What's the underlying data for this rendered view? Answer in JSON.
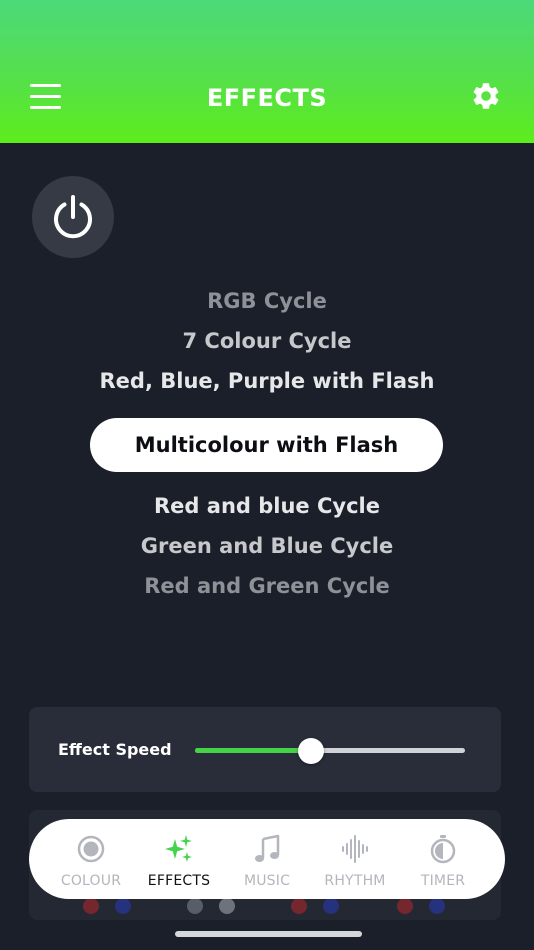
{
  "header": {
    "title": "EFFECTS",
    "background_color": "#55e04a",
    "menu_icon": "hamburger-menu-icon",
    "settings_icon": "gear-icon"
  },
  "power": {
    "icon": "power-icon"
  },
  "effects": {
    "items": [
      {
        "label": "RGB Cycle",
        "color": "#8e9197"
      },
      {
        "label": "7 Colour Cycle",
        "color": "#c6c8cc"
      },
      {
        "label": "Red, Blue, Purple with Flash",
        "color": "#e6e7e9"
      },
      {
        "label": "Multicolour with Flash",
        "selected": true
      },
      {
        "label": "Red and blue Cycle",
        "color": "#e6e7e9"
      },
      {
        "label": "Green and Blue Cycle",
        "color": "#c6c8cc"
      },
      {
        "label": "Red and Green Cycle",
        "color": "#8e9197"
      }
    ],
    "selected_index": 3
  },
  "speed": {
    "label": "Effect Speed",
    "value": 0.43,
    "accent_color": "#46d246"
  },
  "tabs": [
    {
      "label": "COLOUR",
      "icon": "colour-icon",
      "active": false
    },
    {
      "label": "EFFECTS",
      "icon": "sparkles-icon",
      "active": true
    },
    {
      "label": "MUSIC",
      "icon": "music-note-icon",
      "active": false
    },
    {
      "label": "RHYTHM",
      "icon": "waveform-icon",
      "active": false
    },
    {
      "label": "TIMER",
      "icon": "timer-icon",
      "active": false
    }
  ]
}
